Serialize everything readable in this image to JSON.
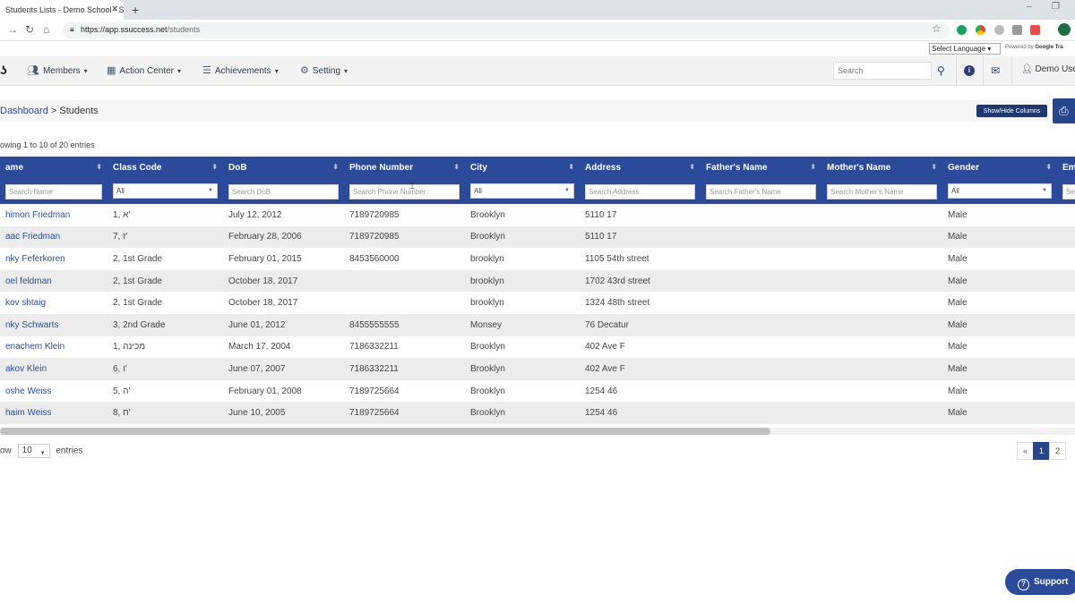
{
  "browser": {
    "tab_title": "Students Lists - Demo School - S",
    "url_host": "https://app.ssuccess.net",
    "url_path": "/students"
  },
  "translate": {
    "select_label": "Select Language",
    "powered_prefix": "Powered by",
    "powered_brand": "Google",
    "powered_suffix": "Tra"
  },
  "nav": {
    "menu": [
      {
        "label": "Members"
      },
      {
        "label": "Action Center"
      },
      {
        "label": "Achievements"
      },
      {
        "label": "Setting"
      }
    ],
    "search_placeholder": "Search",
    "user": "Demo User"
  },
  "breadcrumb": {
    "home": "Dashboard",
    "separator": " > ",
    "current": "Students"
  },
  "show_hide_label": "Show/Hide Columns",
  "showing_text": "owing 1 to 10 of 20 entries",
  "table": {
    "headers": [
      "ame",
      "Class Code",
      "DoB",
      "Phone Number",
      "City",
      "Address",
      "Father's Name",
      "Mother's Name",
      "Gender",
      "Em"
    ],
    "filters": {
      "name": "Search Name",
      "class_code": "All",
      "dob": "Search DoB",
      "phone": "Search Phone Number",
      "city": "All",
      "address": "Search Address",
      "father": "Search Father's Name",
      "mother": "Search Mother's Name",
      "gender": "All",
      "email": "Se"
    },
    "rows": [
      {
        "name": "himon Friedman",
        "class_code": "1, א'",
        "dob": "July 12, 2012",
        "phone": "7189720985",
        "city": "Brooklyn",
        "address": "5110 17",
        "father": "",
        "mother": "",
        "gender": "Male"
      },
      {
        "name": "aac Friedman",
        "class_code": "7, ז'",
        "dob": "February 28, 2006",
        "phone": "7189720985",
        "city": "Brooklyn",
        "address": "5110 17",
        "father": "",
        "mother": "",
        "gender": "Male"
      },
      {
        "name": "nky Feferkoren",
        "class_code": "2, 1st Grade",
        "dob": "February 01, 2015",
        "phone": "8453560000",
        "city": "brooklyn",
        "address": "1105 54th street",
        "father": "",
        "mother": "",
        "gender": "Male"
      },
      {
        "name": "oel feldman",
        "class_code": "2, 1st Grade",
        "dob": "October 18, 2017",
        "phone": "",
        "city": "brooklyn",
        "address": "1702 43rd street",
        "father": "",
        "mother": "",
        "gender": "Male"
      },
      {
        "name": "kov shtaig",
        "class_code": "2, 1st Grade",
        "dob": "October 18, 2017",
        "phone": "",
        "city": "brooklyn",
        "address": "1324 48th street",
        "father": "",
        "mother": "",
        "gender": "Male"
      },
      {
        "name": "nky Schwarts",
        "class_code": "3, 2nd Grade",
        "dob": "June 01, 2012",
        "phone": "8455555555",
        "city": "Monsey",
        "address": "76 Decatur",
        "father": "",
        "mother": "",
        "gender": "Male"
      },
      {
        "name": "enachem Klein",
        "class_code": "1, מכינה",
        "dob": "March 17, 2004",
        "phone": "7186332211",
        "city": "Brooklyn",
        "address": "402 Ave F",
        "father": "",
        "mother": "",
        "gender": "Male"
      },
      {
        "name": "akov Klein",
        "class_code": "6, ו'",
        "dob": "June 07, 2007",
        "phone": "7186332211",
        "city": "Brooklyn",
        "address": "402 Ave F",
        "father": "",
        "mother": "",
        "gender": "Male"
      },
      {
        "name": "oshe Weiss",
        "class_code": "5, ה'",
        "dob": "February 01, 2008",
        "phone": "7189725664",
        "city": "Brooklyn",
        "address": "1254 46",
        "father": "",
        "mother": "",
        "gender": "Male"
      },
      {
        "name": "haim Weiss",
        "class_code": "8, ח'",
        "dob": "June 10, 2005",
        "phone": "7189725664",
        "city": "Brooklyn",
        "address": "1254 46",
        "father": "",
        "mother": "",
        "gender": "Male"
      }
    ]
  },
  "footer": {
    "show_prefix": "ow",
    "page_length": "10",
    "entries_suffix": "entries",
    "pages": [
      "«",
      "1",
      "2"
    ],
    "active_page": "1"
  },
  "support_label": "Support",
  "colors": {
    "primary": "#2b4a9a",
    "nav_bg": "#f3f3f3",
    "link": "#2a4b9a",
    "stripe": "#ececec"
  }
}
